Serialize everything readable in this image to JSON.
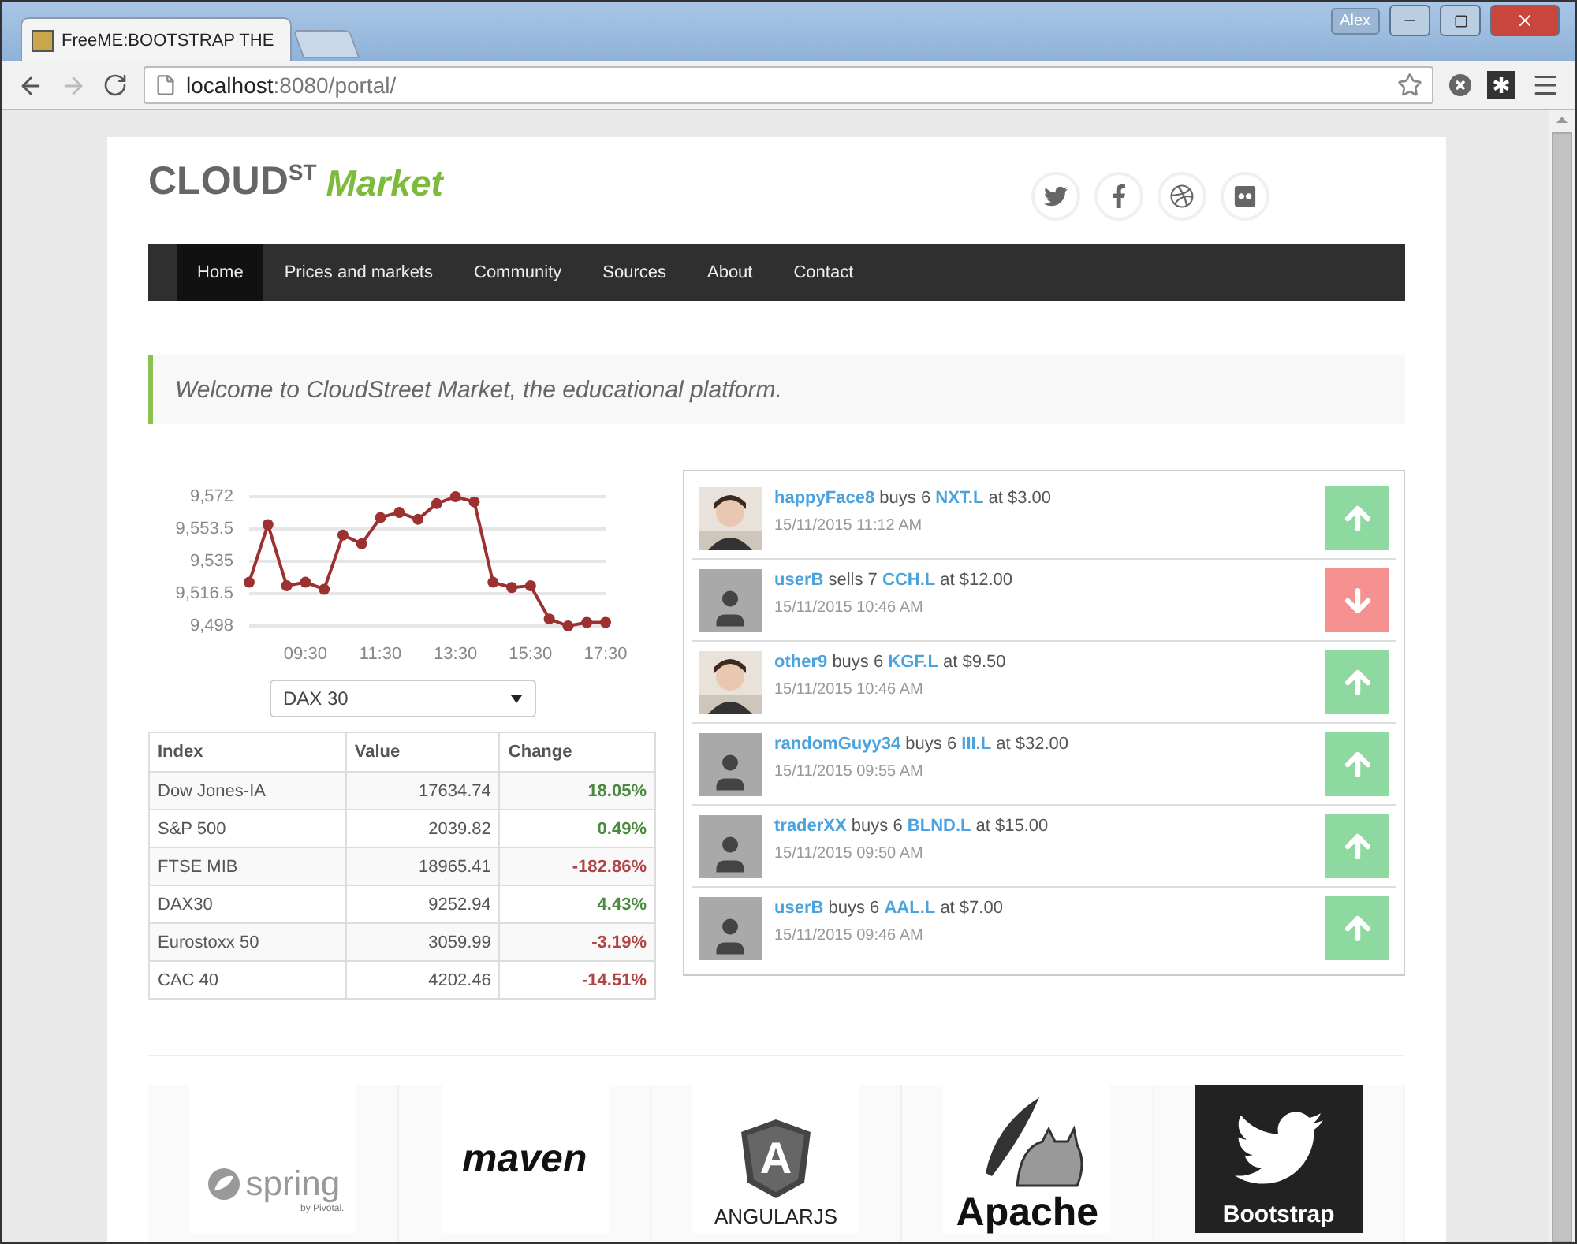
{
  "window": {
    "tab_title": "FreeME:BOOTSTRAP THE",
    "user": "Alex"
  },
  "address_bar": {
    "host": "localhost",
    "path": ":8080/portal/"
  },
  "logo": {
    "word": "CLOUD",
    "sup": "ST",
    "accent": "Market"
  },
  "social": [
    {
      "kind": "twitter"
    },
    {
      "kind": "facebook"
    },
    {
      "kind": "dribbble"
    },
    {
      "kind": "flickr"
    }
  ],
  "nav": [
    {
      "label": "Home",
      "selected": true
    },
    {
      "label": "Prices and markets",
      "selected": false
    },
    {
      "label": "Community",
      "selected": false
    },
    {
      "label": "Sources",
      "selected": false
    },
    {
      "label": "About",
      "selected": false
    },
    {
      "label": "Contact",
      "selected": false
    }
  ],
  "welcome": "Welcome to CloudStreet Market, the educational platform.",
  "chart": {
    "chart_data": {
      "type": "line",
      "x": [
        480,
        510,
        540,
        570,
        600,
        630,
        660,
        690,
        720,
        750,
        780,
        810,
        840,
        870,
        900,
        930,
        960,
        990,
        1020,
        1050
      ],
      "series": [
        {
          "color": "#9b3131",
          "marker": "circle",
          "values": [
            9523,
            9556,
            9521,
            9523,
            9519,
            9550,
            9545,
            9560,
            9563,
            9559,
            9568,
            9572,
            9569,
            9523,
            9520,
            9521,
            9502,
            9498,
            9500,
            9500
          ]
        }
      ],
      "xlim": [
        480,
        1050
      ],
      "ylim": [
        9498,
        9572
      ],
      "grid": true,
      "yticks": [
        {
          "value": 9498,
          "label": "9,498"
        },
        {
          "value": 9516.5,
          "label": "9,516.5"
        },
        {
          "value": 9535,
          "label": "9,535"
        },
        {
          "value": 9553.5,
          "label": "9,553.5"
        },
        {
          "value": 9572,
          "label": "9,572"
        }
      ],
      "xticks": [
        {
          "value": 570,
          "label": "09:30"
        },
        {
          "value": 690,
          "label": "11:30"
        },
        {
          "value": 810,
          "label": "13:30"
        },
        {
          "value": 930,
          "label": "15:30"
        },
        {
          "value": 1050,
          "label": "17:30"
        }
      ]
    }
  },
  "index_select": {
    "value": "DAX 30"
  },
  "index_table": {
    "columns": [
      "Index",
      "Value",
      "Change"
    ],
    "rows": [
      {
        "index": "Dow Jones-IA",
        "value": "17634.74",
        "change": "18.05%",
        "color": "#4a8a3e"
      },
      {
        "index": "S&P 500",
        "value": "2039.82",
        "change": "0.49%",
        "color": "#4a8a3e"
      },
      {
        "index": "FTSE MIB",
        "value": "18965.41",
        "change": "-182.86%",
        "color": "#b04545"
      },
      {
        "index": "DAX30",
        "value": "9252.94",
        "change": "4.43%",
        "color": "#4a8a3e"
      },
      {
        "index": "Eurostoxx 50",
        "value": "3059.99",
        "change": "-3.19%",
        "color": "#b04545"
      },
      {
        "index": "CAC 40",
        "value": "4202.46",
        "change": "-14.51%",
        "color": "#b04545"
      }
    ]
  },
  "feed": [
    {
      "kind": "buy",
      "photo": true,
      "user": "happyFace8",
      "action": "buys 6",
      "ticker": "NXT.L",
      "price": "at $3.00",
      "time": "15/11/2015 11:12 AM"
    },
    {
      "kind": "sell",
      "photo": false,
      "user": "userB",
      "action": "sells 7",
      "ticker": "CCH.L",
      "price": "at $12.00",
      "time": "15/11/2015 10:46 AM"
    },
    {
      "kind": "buy",
      "photo": true,
      "user": "other9",
      "action": "buys 6",
      "ticker": "KGF.L",
      "price": "at $9.50",
      "time": "15/11/2015 10:46 AM"
    },
    {
      "kind": "buy",
      "photo": false,
      "user": "randomGuyy34",
      "action": "buys 6",
      "ticker": "III.L",
      "price": "at $32.00",
      "time": "15/11/2015 09:55 AM"
    },
    {
      "kind": "buy",
      "photo": false,
      "user": "traderXX",
      "action": "buys 6",
      "ticker": "BLND.L",
      "price": "at $15.00",
      "time": "15/11/2015 09:50 AM"
    },
    {
      "kind": "buy",
      "photo": false,
      "user": "userB",
      "action": "buys 6",
      "ticker": "AAL.L",
      "price": "at $7.00",
      "time": "15/11/2015 09:46 AM"
    }
  ],
  "partners": [
    {
      "kind": "spring",
      "name": "spring",
      "sub": "by Pivotal."
    },
    {
      "kind": "maven",
      "name": "maven"
    },
    {
      "kind": "angular",
      "mark": "A",
      "name": "ANGULARJS"
    },
    {
      "kind": "apache",
      "name": "Apache"
    },
    {
      "kind": "bootstrap",
      "name": "Bootstrap"
    }
  ]
}
